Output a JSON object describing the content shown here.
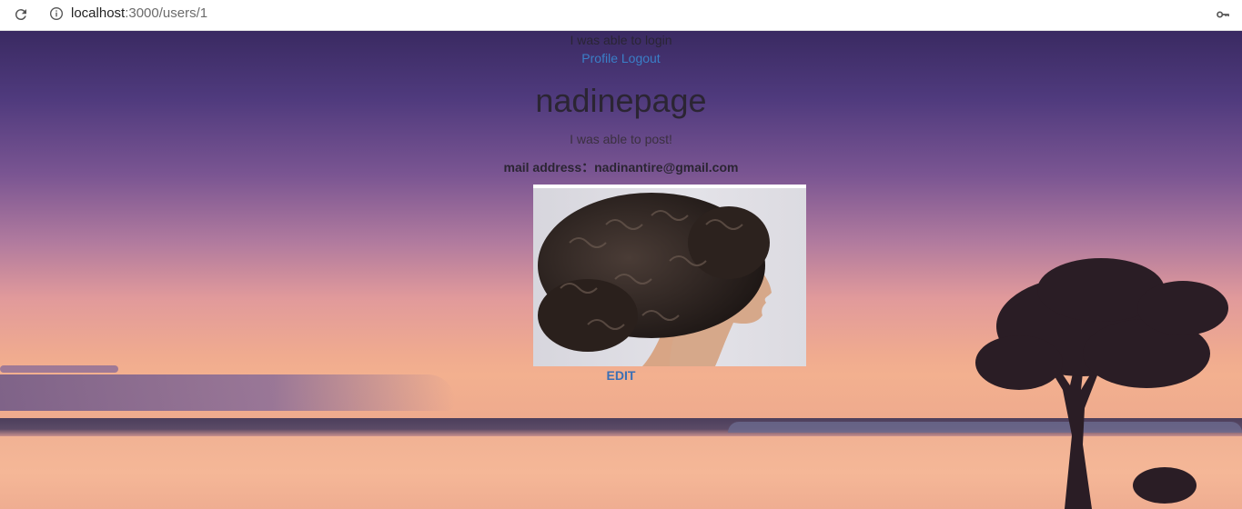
{
  "browser": {
    "url_host": "localhost",
    "url_path": ":3000/users/1"
  },
  "flash": "I was able to login",
  "nav": {
    "profile": "Profile",
    "logout": "Logout"
  },
  "profile": {
    "username": "nadinepage",
    "introduction": "I was able to post!",
    "mail_label": "mail address：",
    "mail_value": "nadinantire@gmail.com",
    "edit_label": "EDIT"
  },
  "icons": {
    "reload": "reload-icon",
    "info": "info-icon",
    "key": "key-icon"
  }
}
